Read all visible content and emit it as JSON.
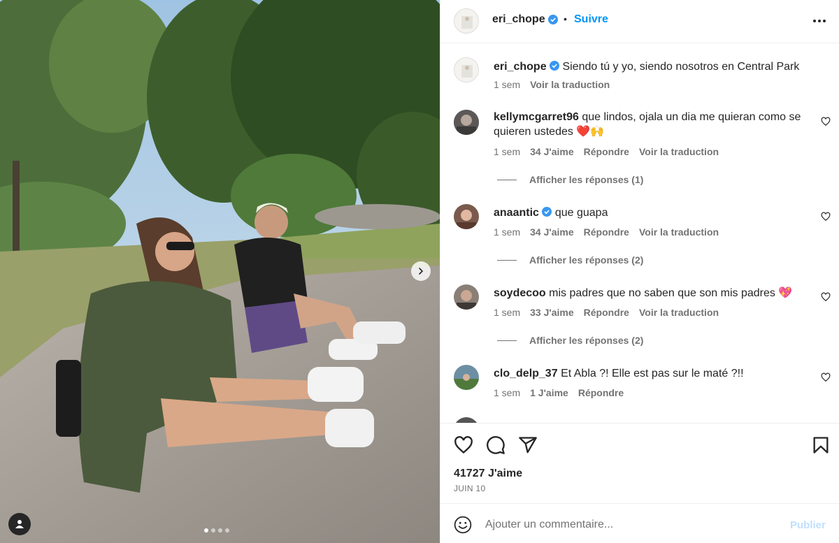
{
  "post": {
    "image_alt": "",
    "carousel": {
      "count": 4,
      "active_index": 0
    }
  },
  "header": {
    "username": "eri_chope",
    "separator": "•",
    "follow_label": "Suivre"
  },
  "caption": {
    "username": "eri_chope",
    "text": "Siendo tú y yo, siendo nosotros en Central Park",
    "time": "1 sem",
    "translate": "Voir la traduction"
  },
  "comments": [
    {
      "username": "kellymcgarret96",
      "text": "que lindos, ojala un dia me quieran como se quieren ustedes ❤️🙌",
      "time": "1 sem",
      "likes": "34 J'aime",
      "reply": "Répondre",
      "translate": "Voir la traduction",
      "replies": "Afficher les réponses (1)"
    },
    {
      "username": "anaantic",
      "text": "que guapa",
      "time": "1 sem",
      "likes": "34 J'aime",
      "reply": "Répondre",
      "translate": "Voir la traduction",
      "replies": "Afficher les réponses (2)"
    },
    {
      "username": "soydecoo",
      "text": "mis padres que no saben que son mis padres 💖",
      "time": "1 sem",
      "likes": "33 J'aime",
      "reply": "Répondre",
      "translate": "Voir la traduction",
      "replies": "Afficher les réponses (2)"
    },
    {
      "username": "clo_delp_37",
      "text": "Et Abla ?! Elle est pas sur le maté ?!!",
      "time": "1 sem",
      "likes": "1 J'aime",
      "reply": "Répondre"
    }
  ],
  "stats": {
    "likes": "41727 J'aime",
    "date": "JUIN 10"
  },
  "composer": {
    "placeholder": "Ajouter un commentaire...",
    "publish_label": "Publier"
  },
  "colors": {
    "accent": "#0095f6",
    "verified": "#3897f0",
    "muted_text": "#737373",
    "publish_disabled": "#c0dffd"
  },
  "icons": [
    "heart-icon",
    "comment-icon",
    "share-icon",
    "bookmark-icon",
    "emoji-icon",
    "verified-icon",
    "chevron-right-icon",
    "person-tag-icon",
    "more-options-icon"
  ]
}
